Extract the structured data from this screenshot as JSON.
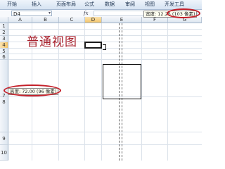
{
  "ribbon": {
    "tabs": [
      "开始",
      "插入",
      "页面布局",
      "公式",
      "数据",
      "审阅",
      "视图",
      "开发工具"
    ]
  },
  "formula_bar": {
    "name_box": "D4",
    "fx": "fx"
  },
  "tooltips": {
    "width": "宽度: 12.25 (103 像素)",
    "height": "高度: 72.00 (96 像素)"
  },
  "columns": [
    "A",
    "B",
    "C",
    "D",
    "E",
    "F",
    "G"
  ],
  "rows": [
    "1",
    "2",
    "3",
    "4",
    "5",
    "6",
    "7",
    "8",
    "9",
    "10"
  ],
  "cells": {
    "b3_text": "普通视图"
  },
  "colors": {
    "selected_header": "#f4c56a",
    "text_accent": "#a8222e",
    "annotation": "#c4202a"
  }
}
